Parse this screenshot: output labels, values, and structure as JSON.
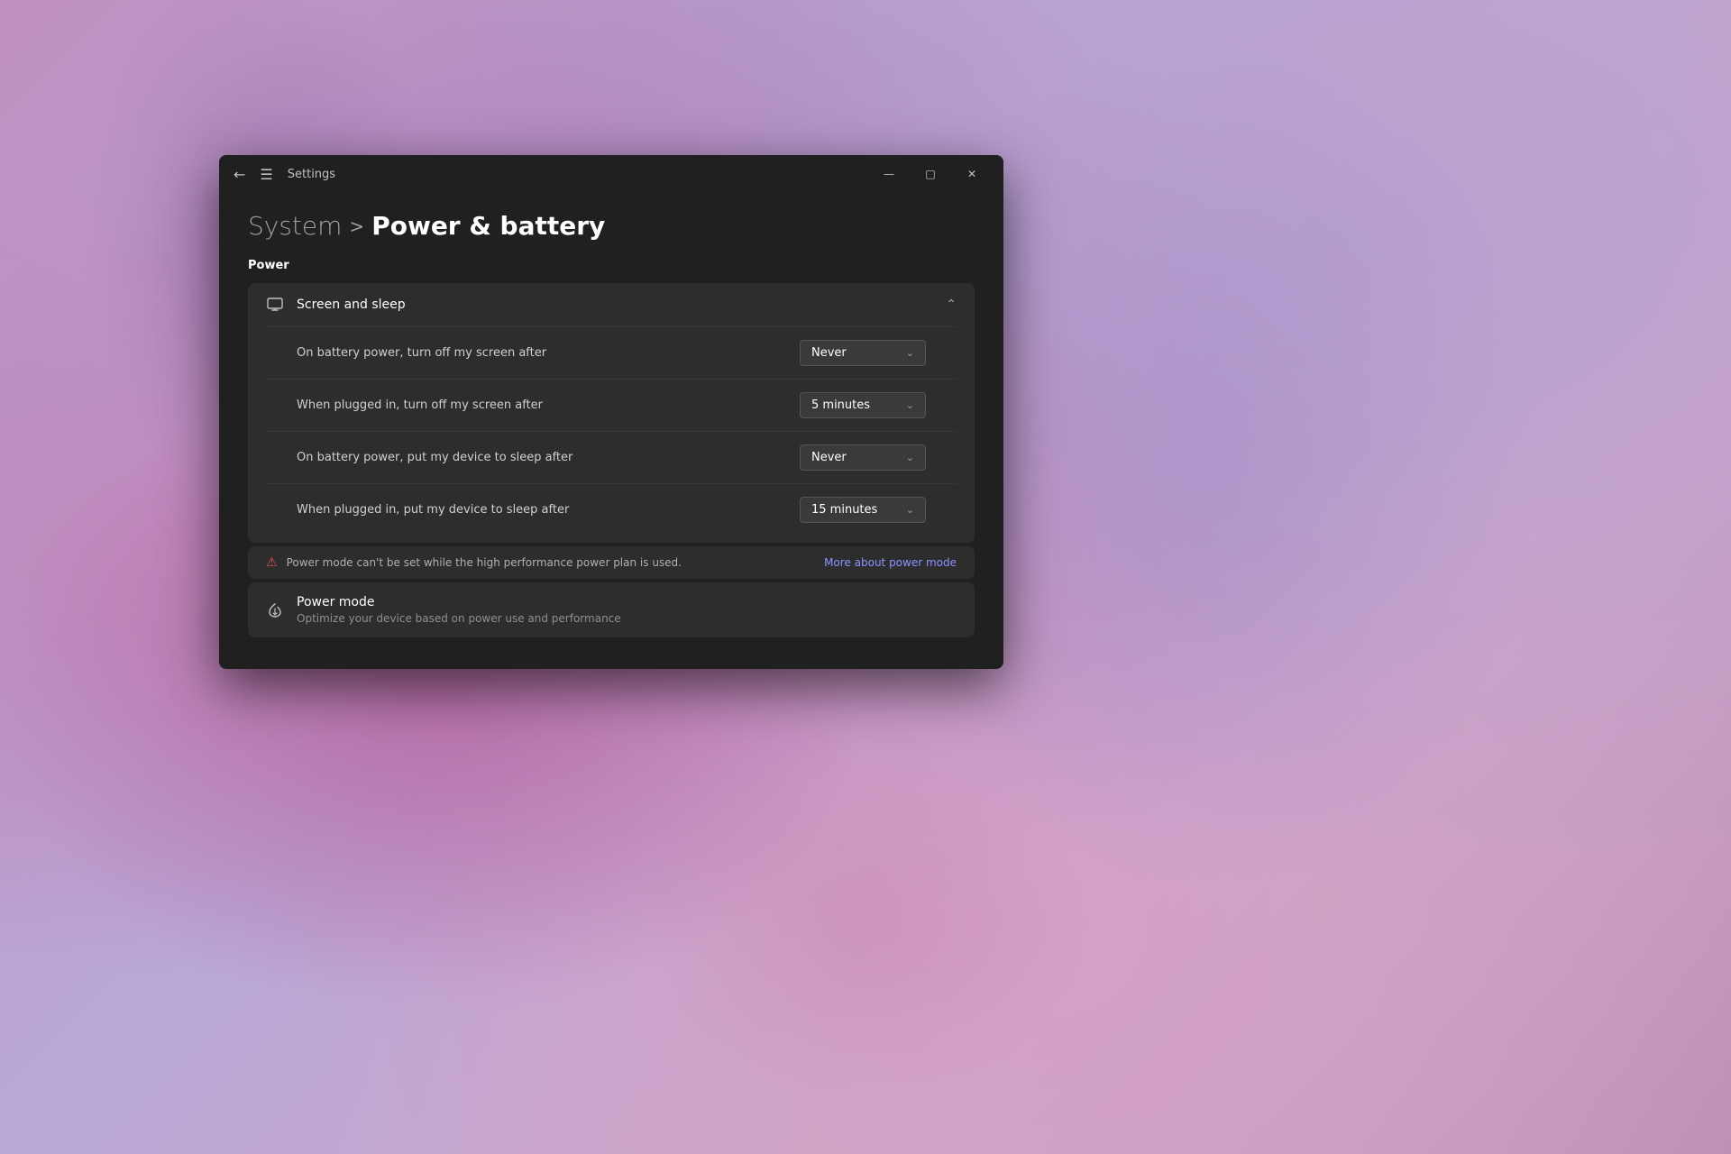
{
  "wallpaper": {
    "description": "Windows 11 purple swirling wallpaper"
  },
  "window": {
    "title": "Settings",
    "titlebar": {
      "back_button": "←",
      "menu_button": "☰",
      "title": "Settings",
      "minimize_label": "—",
      "maximize_label": "□",
      "close_label": "✕"
    },
    "breadcrumb": {
      "parent": "System",
      "separator": ">",
      "current": "Power & battery"
    },
    "sections": {
      "power_label": "Power",
      "screen_sleep": {
        "title": "Screen and sleep",
        "expanded": true,
        "rows": [
          {
            "label": "On battery power, turn off my screen after",
            "value": "Never"
          },
          {
            "label": "When plugged in, turn off my screen after",
            "value": "5 minutes"
          },
          {
            "label": "On battery power, put my device to sleep after",
            "value": "Never"
          },
          {
            "label": "When plugged in, put my device to sleep after",
            "value": "15 minutes"
          }
        ]
      },
      "warning": {
        "text": "Power mode can't be set while the high performance power plan is used.",
        "link_text": "More about power mode"
      },
      "power_mode": {
        "title": "Power mode",
        "description": "Optimize your device based on power use and performance"
      }
    }
  }
}
